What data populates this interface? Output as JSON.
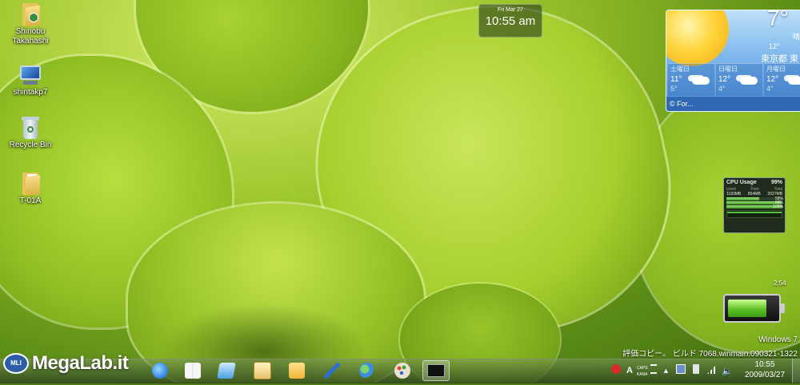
{
  "desktop": {
    "icons": [
      {
        "label": "Shinobu Takahashi"
      },
      {
        "label": "shintakp7"
      },
      {
        "label": "Recycle Bin"
      },
      {
        "label": "T-01A"
      }
    ]
  },
  "clock_gadget": {
    "date": "Fri Mar 27",
    "time": "10:55 am"
  },
  "weather_gadget": {
    "current_temp": "7°",
    "condition": "晴",
    "low": "12°",
    "city": "東京都 東",
    "forecast": [
      {
        "day": "土曜日",
        "hi": "11°",
        "lo": "5°"
      },
      {
        "day": "日曜日",
        "hi": "12°",
        "lo": "4°"
      },
      {
        "day": "月曜日",
        "hi": "12°",
        "lo": "4°"
      }
    ],
    "footer": "© For..."
  },
  "cpu_gadget": {
    "title": "CPU Usage",
    "percent": "99%",
    "columns": [
      "Used",
      "Free",
      "Total"
    ],
    "values": [
      "1183MB",
      "854MB",
      "2037MB"
    ],
    "cores": [
      {
        "label": "Ram",
        "value": "58%",
        "fraction": 0.58
      },
      {
        "label": "Core 1",
        "value": "98%",
        "fraction": 0.98
      },
      {
        "label": "Core 2",
        "value": "100%",
        "fraction": 1.0
      }
    ]
  },
  "battery_gadget": {
    "time_remaining": "2:54",
    "level": 0.75
  },
  "watermark": {
    "os": "Windows 7",
    "build": "評価コピー。 ビルド 7068.winmain.090321-1322"
  },
  "logo": {
    "badge": "MLI",
    "text": "MegaLab.it"
  },
  "taskbar": {
    "pinned": [
      {
        "name": "internet-explorer",
        "color": "#3a8ee6"
      },
      {
        "name": "book-reader",
        "color": "#f2f2f2"
      },
      {
        "name": "blue-app",
        "color": "#4aa0e0"
      },
      {
        "name": "mail-app",
        "color": "#e7c36a"
      },
      {
        "name": "folder-app",
        "color": "#f0c24a"
      },
      {
        "name": "paint-brush",
        "color": "#2c6fd0"
      },
      {
        "name": "messenger",
        "color": "#55b04a"
      },
      {
        "name": "paint-palette",
        "color": "#d9d2c4"
      },
      {
        "name": "command-prompt",
        "color": "#111111"
      }
    ],
    "tray": {
      "ime": "A",
      "ime_sub1": "CAPS",
      "ime_sub2": "KANA"
    },
    "clock": {
      "time": "10:55",
      "date": "2009/03/27"
    }
  }
}
